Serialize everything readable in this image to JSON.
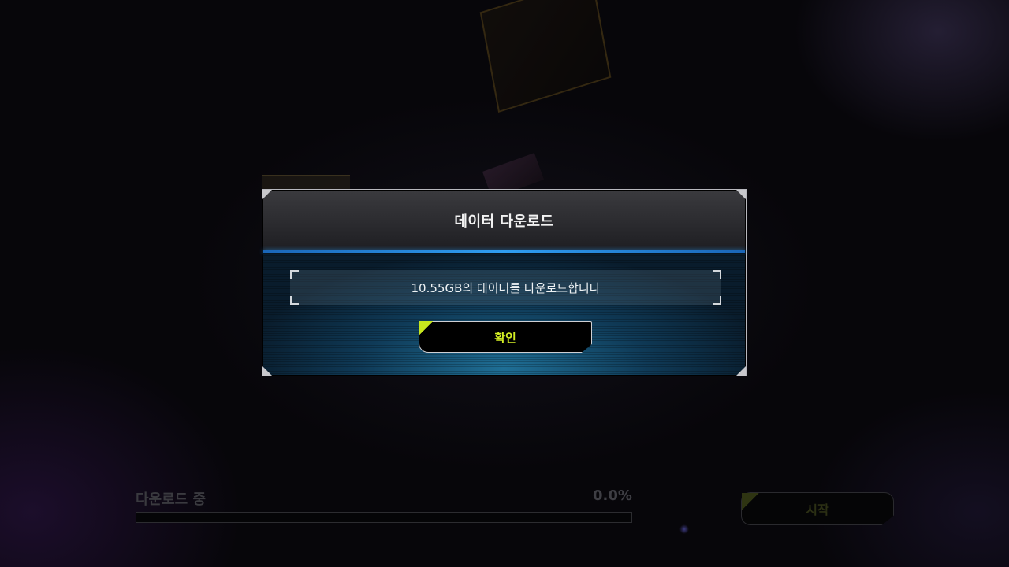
{
  "dialog": {
    "title": "데이터 다운로드",
    "message": "10.55GB의 데이터를 다운로드합니다",
    "confirm_label": "확인"
  },
  "download": {
    "status_label": "다운로드 중",
    "percent_text": "0.0%",
    "progress": 0.0,
    "start_label": "시작"
  },
  "colors": {
    "accent_lime": "#d2ec24",
    "header_line_blue": "#2f9ef2",
    "panel_body": "#0f3a57"
  }
}
